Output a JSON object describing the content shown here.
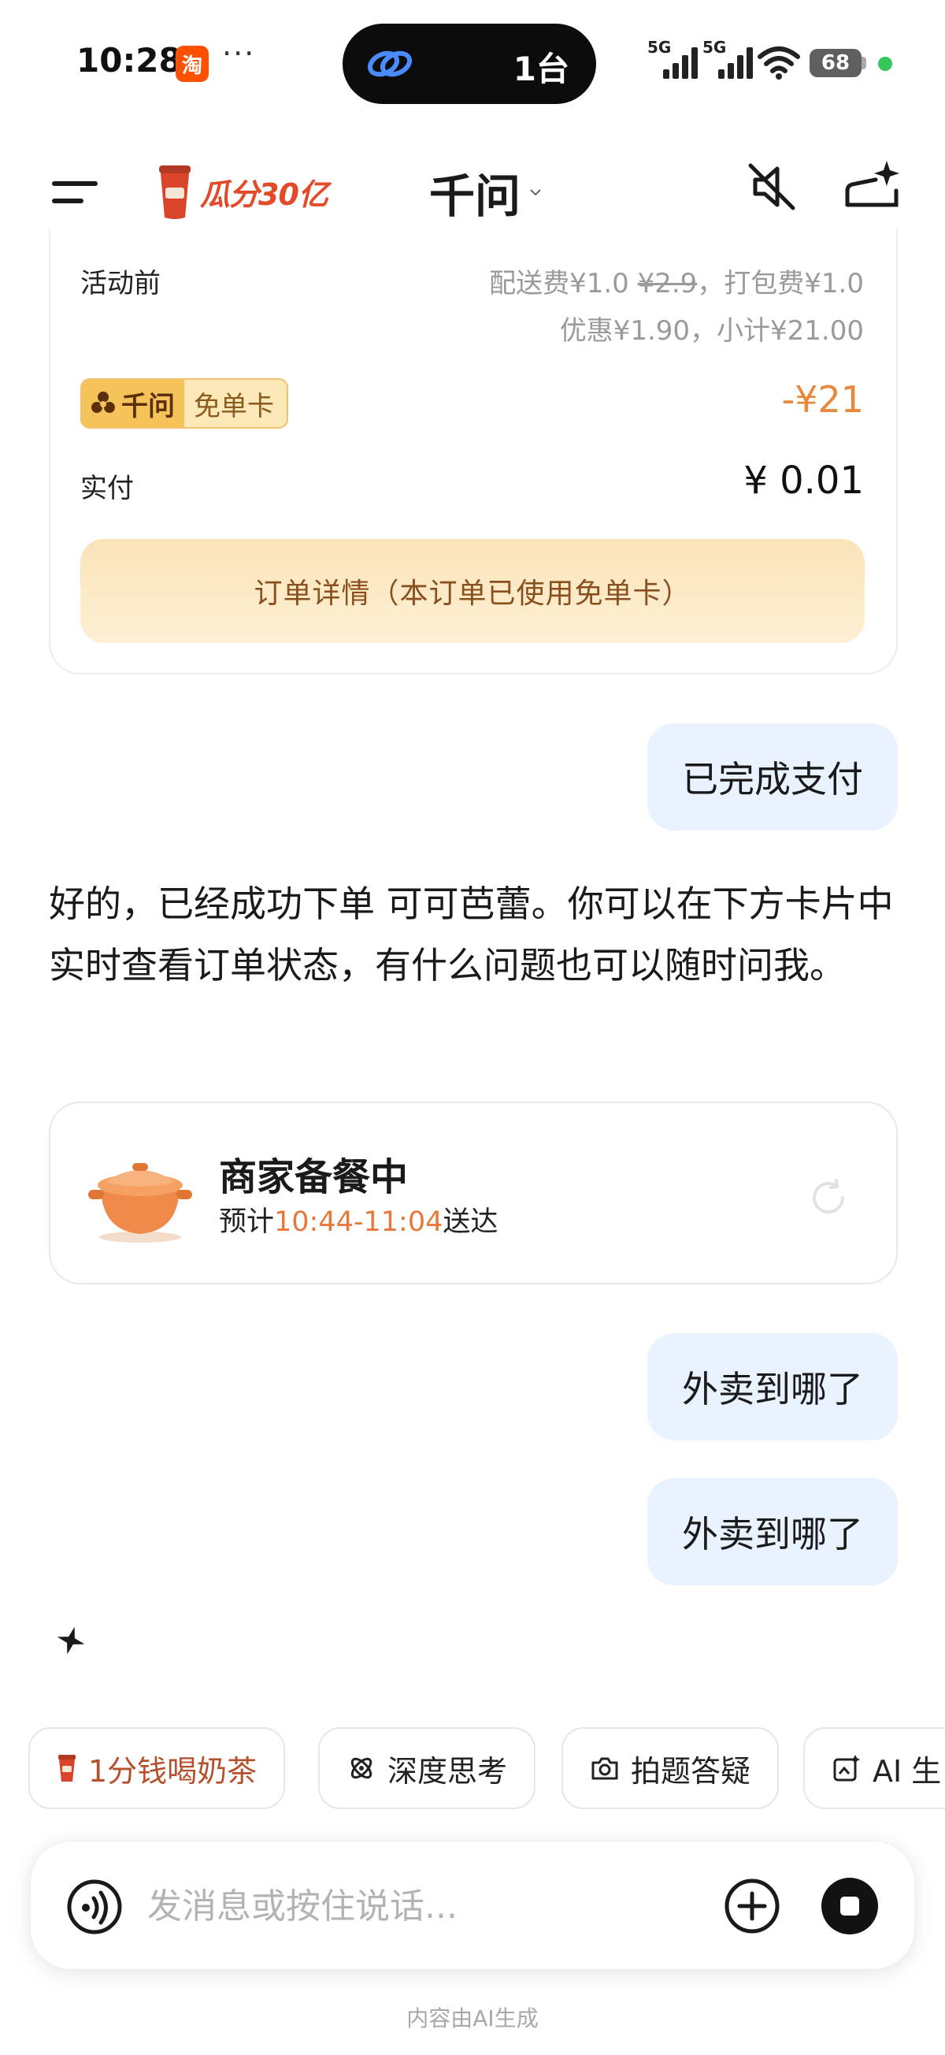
{
  "status_bar": {
    "time": "10:28",
    "notification_app": "淘",
    "more": "···",
    "island_text": "1台",
    "signal1_label": "5G",
    "signal2_label": "5G",
    "battery": "68"
  },
  "header": {
    "promo_text": "瓜分30亿",
    "title": "千问"
  },
  "order_summary": {
    "before_label": "活动前",
    "delivery_fee_prefix": "配送费¥1.0 ",
    "delivery_fee_original": "¥2.9",
    "packing_fee": "，打包费¥1.0",
    "discount_subtotal": "优惠¥1.90，小计¥21.00",
    "badge_brand": "千问",
    "badge_label": "免单卡",
    "discount_amount": "-¥21",
    "paid_label": "实付",
    "paid_value": "¥ 0.01",
    "detail_button": "订单详情（本订单已使用免单卡）"
  },
  "messages": {
    "user_1": "已完成支付",
    "ai_1": "好的，已经成功下单 可可芭蕾。你可以在下方卡片中实时查看订单状态，有什么问题也可以随时问我。",
    "user_2": "外卖到哪了",
    "user_3": "外卖到哪了"
  },
  "delivery": {
    "status": "商家备餐中",
    "eta_prefix": "预计",
    "eta_time": "10:44-11:04",
    "eta_suffix": "送达"
  },
  "chips": [
    "1分钱喝奶茶",
    "深度思考",
    "拍题答疑",
    "AI 生"
  ],
  "input": {
    "placeholder": "发消息或按住说话..."
  },
  "footnote": "内容由AI生成",
  "colors": {
    "user_bubble": "#e9f2ff",
    "accent_orange": "#e8883a",
    "detail_button": "#fbe3b8",
    "promo_red": "#e24a2a"
  }
}
